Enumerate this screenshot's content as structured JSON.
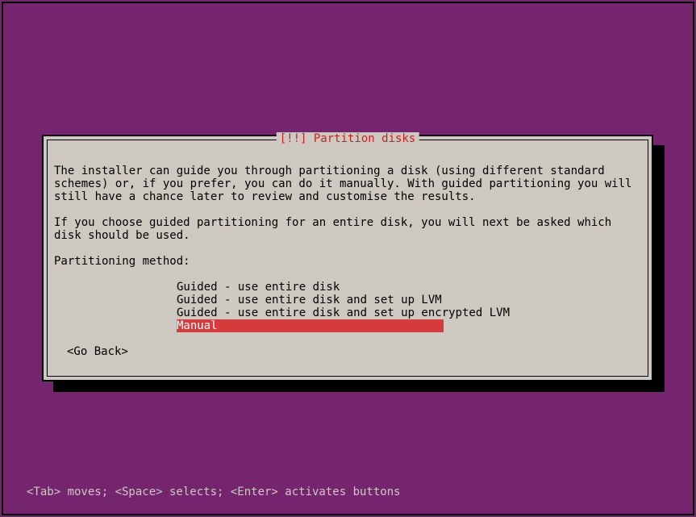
{
  "dialog": {
    "title": "[!!] Partition disks",
    "para1": "The installer can guide you through partitioning a disk (using different standard schemes) or, if you prefer, you can do it manually. With guided partitioning you will still have a chance later to review and customise the results.",
    "para2": "If you choose guided partitioning for an entire disk, you will next be asked which disk should be used.",
    "prompt": "Partitioning method:",
    "options": [
      "Guided - use entire disk",
      "Guided - use entire disk and set up LVM",
      "Guided - use entire disk and set up encrypted LVM",
      "Manual"
    ],
    "goBack": "<Go Back>"
  },
  "footer": "<Tab> moves; <Space> selects; <Enter> activates buttons"
}
